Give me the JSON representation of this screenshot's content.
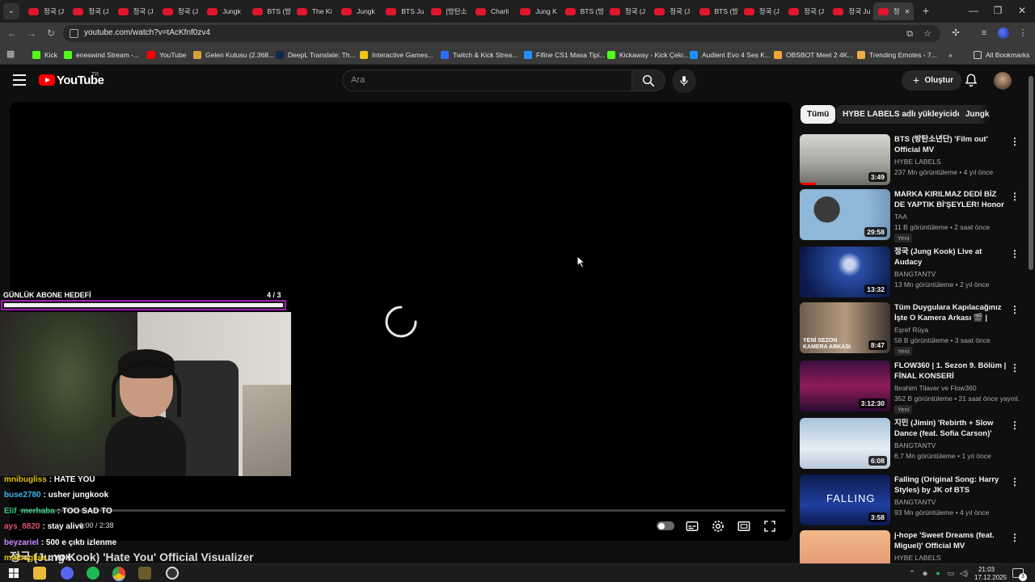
{
  "browser": {
    "tabs": [
      {
        "title": "정국 (J",
        "icon": "youtube-icon"
      },
      {
        "title": "정국 (J",
        "icon": "youtube-icon"
      },
      {
        "title": "정국 (J",
        "icon": "youtube-icon"
      },
      {
        "title": "정국 (J",
        "icon": "youtube-icon"
      },
      {
        "title": "Jungk",
        "icon": "youtube-icon"
      },
      {
        "title": "BTS (방",
        "icon": "youtube-icon"
      },
      {
        "title": "The Ki",
        "icon": "youtube-icon"
      },
      {
        "title": "Jungk",
        "icon": "youtube-icon"
      },
      {
        "title": "BTS Ju",
        "icon": "youtube-icon"
      },
      {
        "title": "[방탄소",
        "icon": "youtube-icon"
      },
      {
        "title": "Charli",
        "icon": "youtube-icon"
      },
      {
        "title": "Jung K",
        "icon": "youtube-icon"
      },
      {
        "title": "BTS (방",
        "icon": "youtube-icon"
      },
      {
        "title": "정국 (J",
        "icon": "youtube-icon"
      },
      {
        "title": "정국 (J",
        "icon": "youtube-icon"
      },
      {
        "title": "BTS (방",
        "icon": "youtube-icon"
      },
      {
        "title": "정국 (J",
        "icon": "youtube-icon"
      },
      {
        "title": "정국 (J",
        "icon": "youtube-icon"
      },
      {
        "title": "정국 Ju",
        "icon": "youtube-icon"
      },
      {
        "title": "정",
        "icon": "youtube-icon",
        "active": true
      }
    ],
    "url": "youtube.com/watch?v=tAcKfnf0zv4",
    "bookmarks": [
      {
        "label": "Kick",
        "color": "#53fc18"
      },
      {
        "label": "eneswind Stream -...",
        "color": "#53fc18"
      },
      {
        "label": "YouTube",
        "color": "#ff0000"
      },
      {
        "label": "Gelen Kutusu (2.368...",
        "color": "#d9a13b"
      },
      {
        "label": "DeepL Translate: Th...",
        "color": "#0f2b46"
      },
      {
        "label": "Interactive Games...",
        "color": "#f0c419"
      },
      {
        "label": "Twitch & Kick Strea...",
        "color": "#2f6df6"
      },
      {
        "label": "Fifine CS1 Masa Tipi...",
        "color": "#1e90ff"
      },
      {
        "label": "Kickaway - Kick Çeki...",
        "color": "#53fc18"
      },
      {
        "label": "Audient Evo 4 Ses K...",
        "color": "#1e90ff"
      },
      {
        "label": "OBSBOT Meet 2 4K...",
        "color": "#f2a33a"
      },
      {
        "label": "Trending Emotes - 7...",
        "color": "#e9b04a"
      }
    ],
    "more_bookmarks": "»",
    "all_bookmarks": "All Bookmarks"
  },
  "youtube": {
    "wordmark": "YouTube",
    "country": "TR",
    "search_placeholder": "Ara",
    "create_label": "Oluştur",
    "video_title": "정국 (Jung Kook) 'Hate You' Official Visualizer",
    "time_display": "0:00 / 2:38",
    "chips": [
      {
        "label": "Tümü",
        "active": true
      },
      {
        "label": "HYBE LABELS adlı yükleyiciden",
        "active": false
      },
      {
        "label": "Jungk",
        "active": false
      }
    ],
    "recommendations": [
      {
        "title": "BTS (방탄소년단) 'Film out' Official MV",
        "channel": "HYBE LABELS",
        "views": "237 Mn görüntüleme",
        "age": "4 yıl önce",
        "duration": "3:49",
        "badge": "",
        "watched": true
      },
      {
        "title": "MARKA KIRILMAZ DEDİ BİZ DE YAPTIK Bİ'ŞEYLER!  Honor ...",
        "channel": "TAA",
        "views": "11 B görüntüleme",
        "age": "2 saat önce",
        "duration": "29:58",
        "badge": "Yeni",
        "watched": false
      },
      {
        "title": "정국 (Jung Kook) Live at Audacy",
        "channel": "BANGTANTV",
        "views": "13 Mn görüntüleme",
        "age": "2 yıl önce",
        "duration": "13:32",
        "badge": "",
        "watched": false
      },
      {
        "title": "Tüm Duygulara Kapılacağınız İşte O Kamera Arkası 🎬 | Eşr...",
        "channel": "Eşref Rüya",
        "views": "58 B görüntüleme",
        "age": "3 saat önce",
        "duration": "8:47",
        "badge": "Yeni",
        "watched": false
      },
      {
        "title": "FLOW360 | 1. Sezon 9. Bölüm | FİNAL KONSERİ",
        "channel": "İbrahim Tilaver     ve Flow360",
        "views": "352 B görüntüleme",
        "age": "21 saat önce yayınl...",
        "duration": "3:12:30",
        "badge": "Yeni",
        "watched": false
      },
      {
        "title": "지민 (Jimin) 'Rebirth + Slow Dance (feat. Sofia Carson)' Liv...",
        "channel": "BANGTANTV",
        "views": "6,7 Mn görüntüleme",
        "age": "1 yıl önce",
        "duration": "6:08",
        "badge": "",
        "watched": false
      },
      {
        "title": "Falling (Original Song: Harry Styles) by JK of BTS",
        "channel": "BANGTANTV",
        "views": "93 Mn görüntüleme",
        "age": "4 yıl önce",
        "duration": "3:58",
        "badge": "",
        "watched": false
      },
      {
        "title": "j-hope 'Sweet Dreams (feat. Miguel)' Official MV",
        "channel": "HYBE LABELS",
        "views": "",
        "age": "",
        "duration": "",
        "badge": "",
        "watched": false
      }
    ],
    "thumb_texts": {
      "t4": "YENİ SEZON KAMERA ARKASI",
      "t7": "FALLING"
    }
  },
  "overlay": {
    "goal_label": "GÜNLÜK ABONE HEDEFİ",
    "goal_count": "4  / 3",
    "goal_progress": 1.0,
    "chat": [
      {
        "user": "mnibugliss",
        "text": ": HATE YOU",
        "color": "#e6c200"
      },
      {
        "user": "buse2780",
        "text": ": usher jungkook",
        "color": "#3fb7e9"
      },
      {
        "user": "Elif_merhaba",
        "text": ": TOO SAD TO",
        "color": "#3cc47c"
      },
      {
        "user": "ays_8820",
        "text": ": stay alive",
        "color": "#e0506a"
      },
      {
        "user": "beyzariel",
        "text": ": 500 e çıktı izlenme",
        "color": "#c78aff"
      },
      {
        "user": "mnibugliss",
        "text": ": YOK",
        "color": "#e6c200"
      }
    ]
  },
  "taskbar": {
    "time": "21:03",
    "date": "17.12.2025",
    "notifications": "3"
  }
}
